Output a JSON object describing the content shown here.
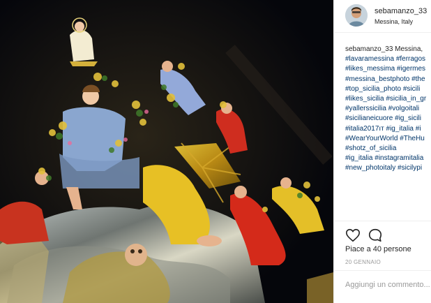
{
  "post": {
    "image_alt": "Vara di Messina procession float",
    "author": {
      "username": "sebamanzo_33",
      "location": "Messina, Italy",
      "avatar_icon": "user-avatar"
    },
    "caption_lines": [
      {
        "owner": "sebamanzo_33",
        "text": " Messina,"
      },
      {
        "owner": "",
        "text": "#lavaramessina #ferragos"
      },
      {
        "owner": "",
        "text": "#likes_messima #igermes"
      },
      {
        "owner": "",
        "text": "#messina_bestphoto #the"
      },
      {
        "owner": "",
        "text": "#top_sicilia_photo #sicili"
      },
      {
        "owner": "",
        "text": "#likes_sicilia #sicilia_in_gr"
      },
      {
        "owner": "",
        "text": "#yallerssicilia #volgoitali"
      },
      {
        "owner": "",
        "text": "#sicilianeicuore #ig_sicili"
      },
      {
        "owner": "",
        "text": "#italia2017ıт #ig_italia #i"
      },
      {
        "owner": "",
        "text": "#WearYourWorld #TheHu"
      },
      {
        "owner": "",
        "text": "#shotz_of_sicilia"
      },
      {
        "owner": "",
        "text": "#ig_italia #instagramitalia"
      },
      {
        "owner": "",
        "text": "#new_photoitaly #sicilypi"
      }
    ],
    "actions": {
      "like_icon": "heart-icon",
      "comment_icon": "comment-icon"
    },
    "likes_text": "Piace a 40 persone",
    "date": "20 GENNAIO",
    "comment_placeholder": "Aggiungi un commento..."
  },
  "colors": {
    "hashtag": "#003569",
    "text": "#262626",
    "muted": "#999999",
    "border": "#efefef"
  }
}
